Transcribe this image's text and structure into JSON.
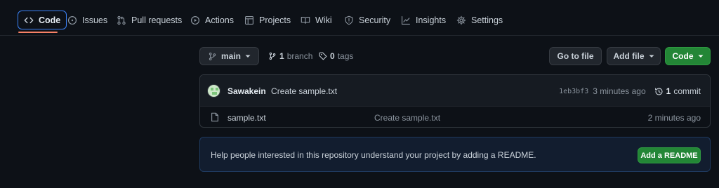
{
  "nav": {
    "items": [
      {
        "label": "Code",
        "icon": "code-icon"
      },
      {
        "label": "Issues",
        "icon": "issue-opened-icon"
      },
      {
        "label": "Pull requests",
        "icon": "git-pull-request-icon"
      },
      {
        "label": "Actions",
        "icon": "play-icon"
      },
      {
        "label": "Projects",
        "icon": "table-icon"
      },
      {
        "label": "Wiki",
        "icon": "book-icon"
      },
      {
        "label": "Security",
        "icon": "shield-icon"
      },
      {
        "label": "Insights",
        "icon": "graph-icon"
      },
      {
        "label": "Settings",
        "icon": "gear-icon"
      }
    ],
    "active": "Code"
  },
  "controls": {
    "branch_label": "main",
    "branch_count": "1",
    "branch_word": "branch",
    "tag_count": "0",
    "tag_word": "tags",
    "go_to_file": "Go to file",
    "add_file": "Add file",
    "code": "Code"
  },
  "commit": {
    "author": "Sawakein",
    "message": "Create sample.txt",
    "sha": "1eb3bf3",
    "age": "3 minutes ago",
    "count": "1",
    "count_word": "commit"
  },
  "files": [
    {
      "name": "sample.txt",
      "message": "Create sample.txt",
      "age": "2 minutes ago"
    }
  ],
  "readme": {
    "text": "Help people interested in this repository understand your project by adding a README.",
    "button": "Add a README"
  },
  "colors": {
    "background": "#0d1117",
    "accent_green": "#238636",
    "active_border": "#3b82f6",
    "active_underline": "#f78166"
  }
}
